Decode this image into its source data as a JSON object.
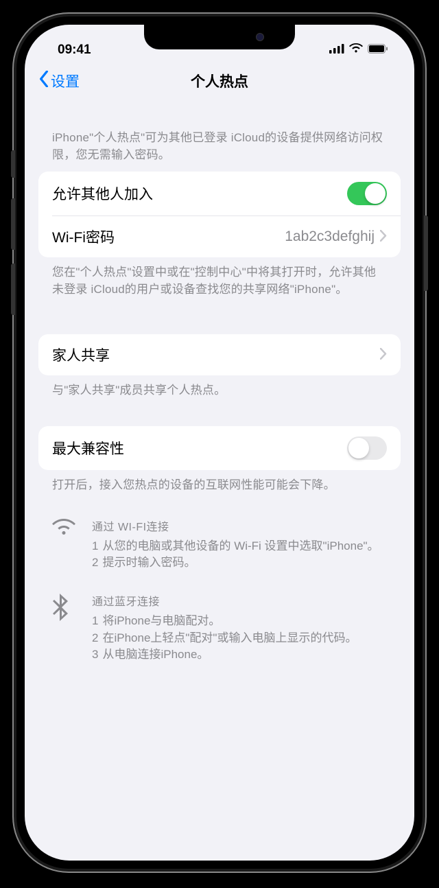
{
  "status": {
    "time": "09:41"
  },
  "nav": {
    "back_label": "设置",
    "title": "个人热点"
  },
  "header_note": "iPhone\"个人热点\"可为其他已登录 iCloud的设备提供网络访问权限，您无需输入密码。",
  "allow_others": {
    "label": "允许其他人加入",
    "on": true
  },
  "wifi_password": {
    "label": "Wi-Fi密码",
    "value": "1ab2c3defghij"
  },
  "allow_footer": "您在\"个人热点\"设置中或在\"控制中心\"中将其打开时，允许其他未登录 iCloud的用户或设备查找您的共享网络\"iPhone\"。",
  "family": {
    "label": "家人共享",
    "footer": "与\"家人共享\"成员共享个人热点。"
  },
  "compat": {
    "label": "最大兼容性",
    "on": false,
    "footer": "打开后，接入您热点的设备的互联网性能可能会下降。"
  },
  "instructions": {
    "wifi": {
      "title": "通过 WI-FI连接",
      "steps": [
        "从您的电脑或其他设备的 Wi-Fi 设置中选取\"iPhone\"。",
        "提示时输入密码。"
      ]
    },
    "bluetooth": {
      "title": "通过蓝牙连接",
      "steps": [
        "将iPhone与电脑配对。",
        "在iPhone上轻点\"配对\"或输入电脑上显示的代码。",
        "从电脑连接iPhone。"
      ]
    }
  }
}
